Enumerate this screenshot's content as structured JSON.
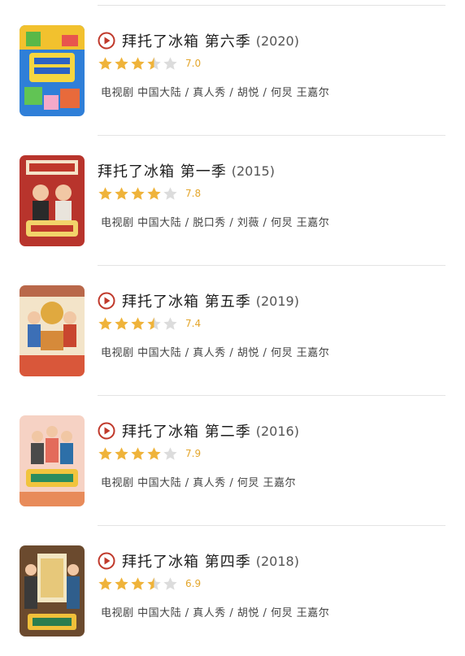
{
  "colors": {
    "star_on": "#efb33a",
    "star_off": "#dcdcdc",
    "score": "#e4a62c",
    "play": "#c0392b"
  },
  "icons": {
    "play": "play-circle-icon",
    "star": "star-icon"
  },
  "items": [
    {
      "title": "拜托了冰箱 第六季",
      "year": "(2020)",
      "stars": 3.5,
      "score": "7.0",
      "meta": "电视剧  中国大陆 / 真人秀 / 胡悦 / 何炅 王嘉尔"
    },
    {
      "title": "拜托了冰箱 第一季",
      "year": "(2015)",
      "stars": 4,
      "score": "7.8",
      "meta": "电视剧  中国大陆 / 脱口秀 / 刘薇 / 何炅 王嘉尔"
    },
    {
      "title": "拜托了冰箱 第五季",
      "year": "(2019)",
      "stars": 3.5,
      "score": "7.4",
      "meta": "电视剧  中国大陆 / 真人秀 / 胡悦 / 何炅 王嘉尔"
    },
    {
      "title": "拜托了冰箱 第二季",
      "year": "(2016)",
      "stars": 4,
      "score": "7.9",
      "meta": "电视剧  中国大陆 / 真人秀 / 何炅 王嘉尔"
    },
    {
      "title": "拜托了冰箱 第四季",
      "year": "(2018)",
      "stars": 3.5,
      "score": "6.9",
      "meta": "电视剧  中国大陆 / 真人秀 / 胡悦 / 何炅 王嘉尔"
    }
  ]
}
